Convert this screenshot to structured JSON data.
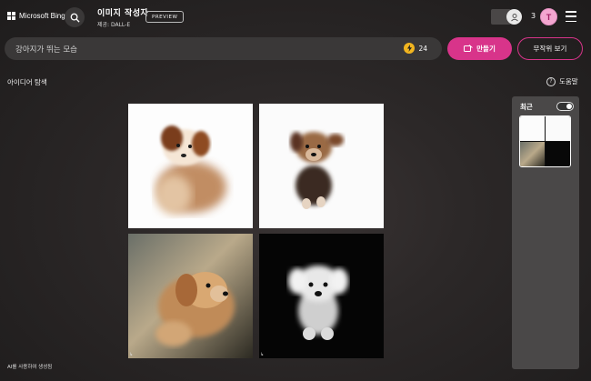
{
  "header": {
    "logo_text": "Microsoft Bing",
    "title": "이미지 작성자",
    "subtitle": "제공: DALL-E",
    "preview_badge": "PREVIEW",
    "coin_count": "3",
    "reward_letter": "T"
  },
  "prompt": {
    "value": "강아지가 뛰는 모습",
    "boost_count": "24",
    "create_label": "만들기",
    "surprise_label": "무작위 보기"
  },
  "content": {
    "explore_label": "아이디어 탐색",
    "help_label": "도움말",
    "ai_note": "AI를 사용하여 생성됨"
  },
  "recent": {
    "label": "최근",
    "toggle_on": true
  },
  "images": [
    {
      "name": "puppy-blurred-white-1"
    },
    {
      "name": "puppy-running-white-2"
    },
    {
      "name": "puppy-motion-blur-3"
    },
    {
      "name": "puppy-dark-background-4"
    }
  ],
  "colors": {
    "accent": "#d8348a",
    "boost": "#f2b51f",
    "panel": "#4a4848"
  }
}
